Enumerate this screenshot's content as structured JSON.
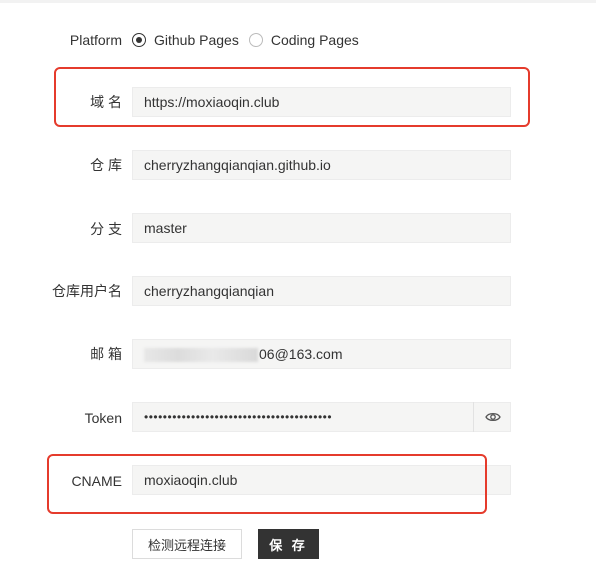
{
  "form": {
    "platform": {
      "label": "Platform",
      "options": [
        {
          "label": "Github Pages",
          "selected": true
        },
        {
          "label": "Coding Pages",
          "selected": false
        }
      ]
    },
    "domain": {
      "label": "域 名",
      "value": "https://moxiaoqin.club"
    },
    "repo": {
      "label": "仓 库",
      "value": "cherryzhangqianqian.github.io"
    },
    "branch": {
      "label": "分 支",
      "value": "master"
    },
    "username": {
      "label": "仓库用户名",
      "value": "cherryzhangqianqian"
    },
    "email": {
      "label": "邮 箱",
      "value_visible": "06@163.com"
    },
    "token": {
      "label": "Token",
      "value": "••••••••••••••••••••••••••••••••••••••••"
    },
    "cname": {
      "label": "CNAME",
      "value": "moxiaoqin.club"
    }
  },
  "buttons": {
    "test_connection": "检测远程连接",
    "save": "保 存"
  },
  "icons": {
    "eye": "eye-icon"
  },
  "colors": {
    "highlight": "#e53b2c",
    "primary_button": "#333333",
    "field_background": "#f5f5f4"
  }
}
